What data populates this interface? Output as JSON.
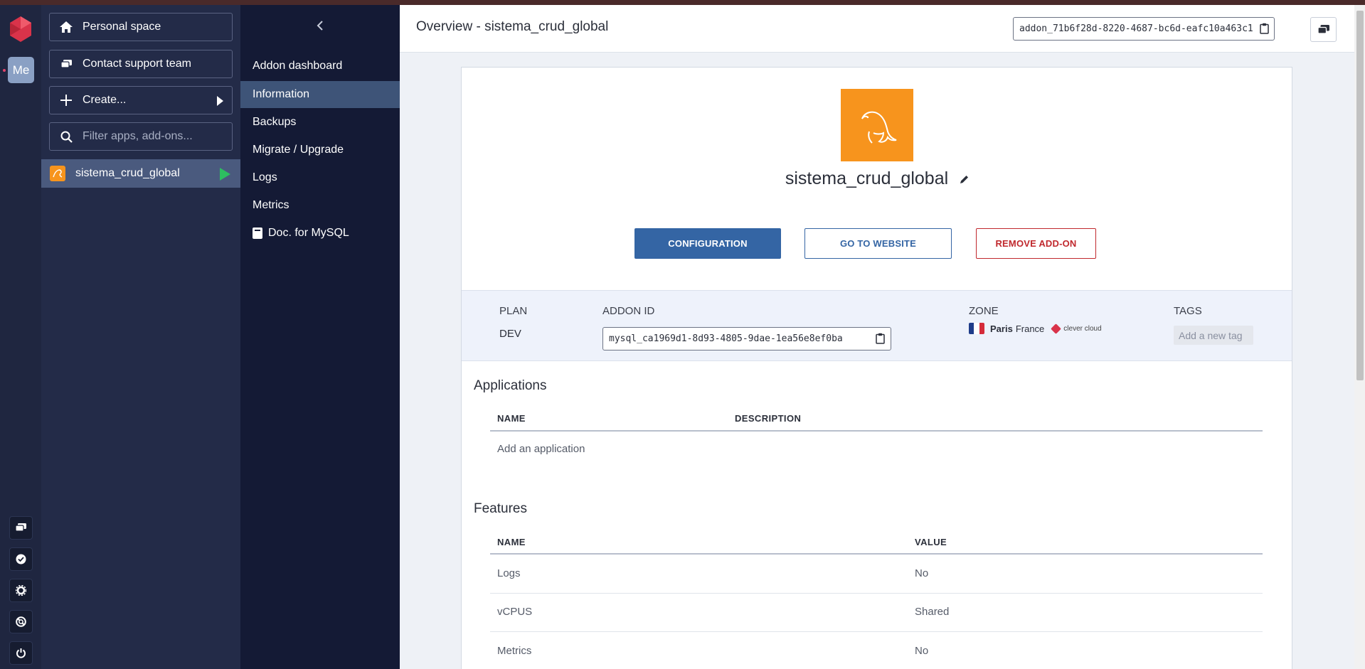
{
  "sidebar_rail": {
    "me_label": "Me"
  },
  "apps_panel": {
    "personal_space": "Personal space",
    "contact_support": "Contact support team",
    "create": "Create...",
    "filter_placeholder": "Filter apps, add-ons...",
    "selected_app": "sistema_crud_global"
  },
  "menu": {
    "items": [
      {
        "label": "Addon dashboard"
      },
      {
        "label": "Information"
      },
      {
        "label": "Backups"
      },
      {
        "label": "Migrate / Upgrade"
      },
      {
        "label": "Logs"
      },
      {
        "label": "Metrics"
      },
      {
        "label": "Doc. for MySQL"
      }
    ],
    "active": "Information"
  },
  "header": {
    "title": "Overview - sistema_crud_global",
    "addon_id": "addon_71b6f28d-8220-4687-bc6d-eafc10a463c1"
  },
  "addon": {
    "name": "sistema_crud_global",
    "buttons": {
      "configuration": "CONFIGURATION",
      "go_to_website": "GO TO WEBSITE",
      "remove": "REMOVE ADD-ON"
    },
    "info": {
      "plan_label": "PLAN",
      "plan_value": "DEV",
      "addon_id_label": "ADDON ID",
      "addon_id_value": "mysql_ca1969d1-8d93-4805-9dae-1ea56e8ef0ba",
      "zone_label": "ZONE",
      "zone_city": "Paris",
      "zone_country": "France",
      "zone_provider": "clever cloud",
      "tags_label": "TAGS",
      "tags_placeholder": "Add a new tag"
    }
  },
  "applications": {
    "title": "Applications",
    "columns": [
      "NAME",
      "DESCRIPTION"
    ],
    "empty_text": "Add an application"
  },
  "features": {
    "title": "Features",
    "columns": [
      "NAME",
      "VALUE"
    ],
    "rows": [
      {
        "name": "Logs",
        "value": "No"
      },
      {
        "name": "vCPUS",
        "value": "Shared"
      },
      {
        "name": "Metrics",
        "value": "No"
      }
    ]
  },
  "colors": {
    "primary": "#3465a4",
    "danger": "#c0282d",
    "mysql_orange": "#f7941d",
    "active_menu": "#3e5478",
    "running_green": "#2dbe60"
  },
  "icons": [
    "home-icon",
    "chat-icon",
    "plus-icon",
    "search-icon",
    "mysql-dolphin-icon",
    "pencil-icon",
    "clipboard-icon",
    "book-icon",
    "chevron-left-icon",
    "check-circle-icon",
    "gear-icon",
    "lifebuoy-icon",
    "power-icon"
  ]
}
